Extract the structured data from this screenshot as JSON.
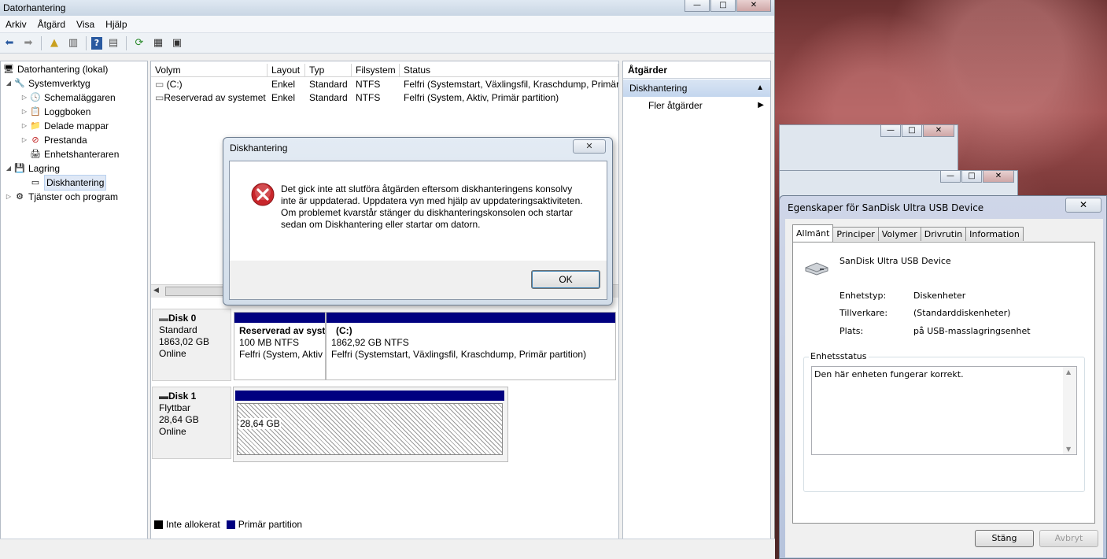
{
  "main_window": {
    "title": "Datorhantering",
    "controls": {
      "minimize": "—",
      "maximize": "□",
      "close": "✕"
    }
  },
  "menu": [
    "Arkiv",
    "Åtgärd",
    "Visa",
    "Hjälp"
  ],
  "toolbar_icons": [
    "back-arrow-icon",
    "forward-arrow-icon",
    "up-folder-icon",
    "show-hide-tree-icon",
    "help-icon",
    "show-hide-action-icon",
    "refresh-icon",
    "properties-icon",
    "export-icon"
  ],
  "tree": {
    "root": "Datorhantering (lokal)",
    "items": [
      {
        "label": "Systemverktyg",
        "level": 1,
        "expanded": true
      },
      {
        "label": "Schemaläggaren",
        "level": 2
      },
      {
        "label": "Loggboken",
        "level": 2
      },
      {
        "label": "Delade mappar",
        "level": 2
      },
      {
        "label": "Prestanda",
        "level": 2
      },
      {
        "label": "Enhetshanteraren",
        "level": 2
      },
      {
        "label": "Lagring",
        "level": 1,
        "expanded": true
      },
      {
        "label": "Diskhantering",
        "level": 2,
        "selected": true
      },
      {
        "label": "Tjänster och program",
        "level": 1
      }
    ]
  },
  "volume_list": {
    "headers": [
      "Volym",
      "Layout",
      "Typ",
      "Filsystem",
      "Status"
    ],
    "rows": [
      [
        "(C:)",
        "Enkel",
        "Standard",
        "NTFS",
        "Felfri (Systemstart, Växlingsfil, Kraschdump, Primär p"
      ],
      [
        "Reserverad av systemet",
        "Enkel",
        "Standard",
        "NTFS",
        "Felfri (System, Aktiv, Primär partition)"
      ]
    ]
  },
  "disks": [
    {
      "name": "Disk 0",
      "type": "Standard",
      "size": "1863,02 GB",
      "status": "Online",
      "partitions": [
        {
          "name": "Reserverad av syst",
          "size": "100 MB NTFS",
          "status": "Felfri (System, Aktiv"
        },
        {
          "name": "(C:)",
          "size": "1862,92 GB NTFS",
          "status": "Felfri (Systemstart, Växlingsfil, Kraschdump, Primär partition)"
        }
      ]
    },
    {
      "name": "Disk 1",
      "type": "Flyttbar",
      "size": "28,64 GB",
      "status": "Online",
      "partitions": [
        {
          "size": "28,64 GB"
        }
      ]
    }
  ],
  "legend": [
    {
      "label": "Inte allokerat",
      "color": "#000000"
    },
    {
      "label": "Primär partition",
      "color": "#000080"
    }
  ],
  "actions": {
    "header": "Åtgärder",
    "section": "Diskhantering",
    "items": [
      "Fler åtgärder"
    ]
  },
  "error_dialog": {
    "title": "Diskhantering",
    "close": "✕",
    "message": "Det gick inte att slutföra åtgärden eftersom diskhanteringens konsolvy inte är uppdaterad. Uppdatera vyn med hjälp av uppdateringsaktiviteten. Om problemet kvarstår stänger du diskhanteringskonsolen och startar sedan om Diskhantering eller startar om datorn.",
    "ok": "OK"
  },
  "properties_dialog": {
    "title": "Egenskaper för SanDisk Ultra USB Device",
    "close": "✕",
    "tabs": [
      "Allmänt",
      "Principer",
      "Volymer",
      "Drivrutin",
      "Information"
    ],
    "active_tab": "Allmänt",
    "device_name": "SanDisk Ultra USB Device",
    "fields": [
      {
        "label": "Enhetstyp:",
        "value": "Diskenheter"
      },
      {
        "label": "Tillverkare:",
        "value": "(Standarddiskenheter)"
      },
      {
        "label": "Plats:",
        "value": "på USB-masslagringsenhet"
      }
    ],
    "status_group_label": "Enhetsstatus",
    "status_text": "Den här enheten fungerar korrekt.",
    "buttons": {
      "close": "Stäng",
      "cancel": "Avbryt"
    }
  },
  "colors": {
    "primary_partition": "#000080",
    "unallocated": "#000000",
    "error_red": "#c8262b",
    "selection": "#dfe8f6"
  }
}
